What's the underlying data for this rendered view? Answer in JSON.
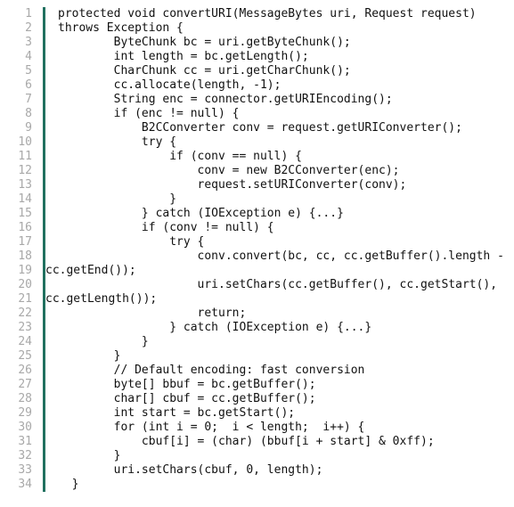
{
  "viewer": {
    "name": "java-source-code-listing",
    "language": "java",
    "colors": {
      "background": "#ffffff",
      "text": "#111111",
      "line_number": "#a8a8a8",
      "gutter_rule": "#20705f"
    },
    "total_lines": 34
  },
  "lines": [
    {
      "num": "1",
      "text": "protected void convertURI(MessageBytes uri, Request request)",
      "continuation": false
    },
    {
      "num": "2",
      "text": "throws Exception {",
      "continuation": false
    },
    {
      "num": "3",
      "text": "        ByteChunk bc = uri.getByteChunk();",
      "continuation": false
    },
    {
      "num": "4",
      "text": "        int length = bc.getLength();",
      "continuation": false
    },
    {
      "num": "5",
      "text": "        CharChunk cc = uri.getCharChunk();",
      "continuation": false
    },
    {
      "num": "6",
      "text": "        cc.allocate(length, -1);",
      "continuation": false
    },
    {
      "num": "7",
      "text": "        String enc = connector.getURIEncoding();",
      "continuation": false
    },
    {
      "num": "8",
      "text": "        if (enc != null) {",
      "continuation": false
    },
    {
      "num": "9",
      "text": "            B2CConverter conv = request.getURIConverter();",
      "continuation": false
    },
    {
      "num": "10",
      "text": "            try {",
      "continuation": false
    },
    {
      "num": "11",
      "text": "                if (conv == null) {",
      "continuation": false
    },
    {
      "num": "12",
      "text": "                    conv = new B2CConverter(enc);",
      "continuation": false
    },
    {
      "num": "13",
      "text": "                    request.setURIConverter(conv);",
      "continuation": false
    },
    {
      "num": "14",
      "text": "                }",
      "continuation": false
    },
    {
      "num": "15",
      "text": "            } catch (IOException e) {...}",
      "continuation": false
    },
    {
      "num": "16",
      "text": "            if (conv != null) {",
      "continuation": false
    },
    {
      "num": "17",
      "text": "                try {",
      "continuation": false
    },
    {
      "num": "18",
      "text": "                    conv.convert(bc, cc, cc.getBuffer().length -",
      "continuation": false
    },
    {
      "num": "19",
      "text": "cc.getEnd());",
      "continuation": true
    },
    {
      "num": "20",
      "text": "                    uri.setChars(cc.getBuffer(), cc.getStart(),",
      "continuation": false
    },
    {
      "num": "21",
      "text": "cc.getLength());",
      "continuation": true
    },
    {
      "num": "22",
      "text": "                    return;",
      "continuation": false
    },
    {
      "num": "23",
      "text": "                } catch (IOException e) {...}",
      "continuation": false
    },
    {
      "num": "24",
      "text": "            }",
      "continuation": false
    },
    {
      "num": "25",
      "text": "        }",
      "continuation": false
    },
    {
      "num": "26",
      "text": "        // Default encoding: fast conversion",
      "continuation": false
    },
    {
      "num": "27",
      "text": "        byte[] bbuf = bc.getBuffer();",
      "continuation": false
    },
    {
      "num": "28",
      "text": "        char[] cbuf = cc.getBuffer();",
      "continuation": false
    },
    {
      "num": "29",
      "text": "        int start = bc.getStart();",
      "continuation": false
    },
    {
      "num": "30",
      "text": "        for (int i = 0;  i < length;  i++) {",
      "continuation": false
    },
    {
      "num": "31",
      "text": "            cbuf[i] = (char) (bbuf[i + start] & 0xff);",
      "continuation": false
    },
    {
      "num": "32",
      "text": "        }",
      "continuation": false
    },
    {
      "num": "33",
      "text": "        uri.setChars(cbuf, 0, length);",
      "continuation": false
    },
    {
      "num": "34",
      "text": "  }",
      "continuation": false
    }
  ]
}
